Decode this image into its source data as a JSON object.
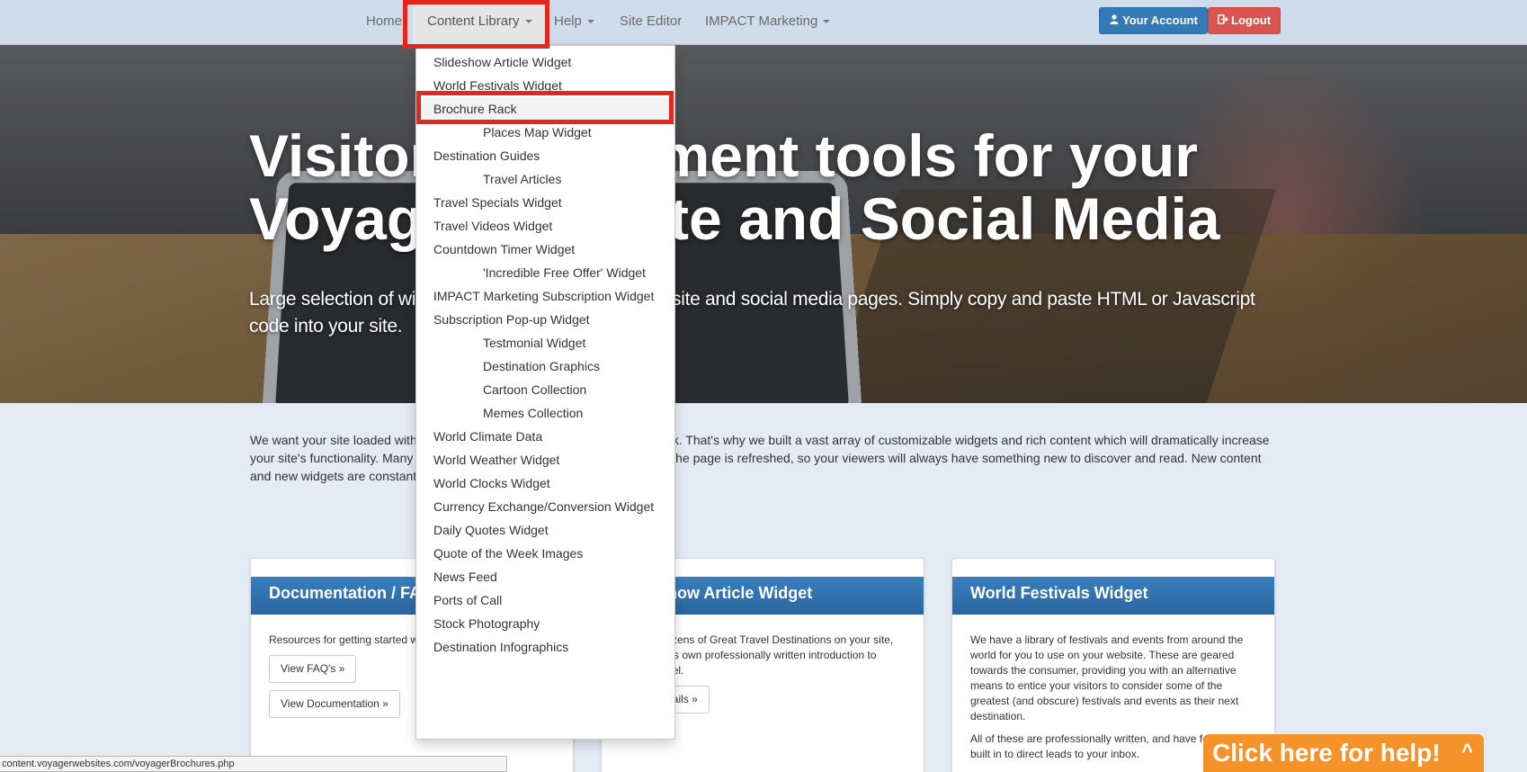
{
  "nav": {
    "home": "Home",
    "content_library": "Content Library",
    "help": "Help",
    "site_editor": "Site Editor",
    "impact_marketing": "IMPACT Marketing",
    "your_account": "Your Account",
    "logout": "Logout"
  },
  "hero": {
    "title_line1": "Visitor engagement tools for your",
    "title_line2": "Voyager Website and Social Media",
    "subtitle": "Large selection of widgets and content for your web site and social media pages. Simply copy and paste HTML or Javascript code into your site."
  },
  "intro": "We want your site loaded with rich content that will keep visitors coming back. That's why we built a vast array of customizable widgets and rich content which will dramatically increase your site's functionality. Many of our widgets deliver new content every time the page is refreshed, so your viewers will always have something new to discover and read. New content and new widgets are constantly added.",
  "dropdown": {
    "items": [
      {
        "label": "Slideshow Article Widget"
      },
      {
        "label": "World Festivals Widget"
      },
      {
        "label": "Brochure Rack"
      },
      {
        "label": "Places Map Widget"
      },
      {
        "label": "Destination Guides"
      },
      {
        "label": "Travel Articles"
      },
      {
        "label": "Travel Specials Widget"
      },
      {
        "label": "Travel Videos Widget"
      },
      {
        "label": "Countdown Timer Widget"
      },
      {
        "label": "'Incredible Free Offer' Widget"
      },
      {
        "label": "IMPACT Marketing Subscription Widget"
      },
      {
        "label": "Subscription Pop-up Widget"
      },
      {
        "label": "Testmonial Widget"
      },
      {
        "label": "Destination Graphics"
      },
      {
        "label": "Cartoon Collection"
      },
      {
        "label": "Memes Collection"
      },
      {
        "label": "World Climate Data"
      },
      {
        "label": "World Weather Widget"
      },
      {
        "label": "World Clocks Widget"
      },
      {
        "label": "Currency Exchange/Conversion Widget"
      },
      {
        "label": "Daily Quotes Widget"
      },
      {
        "label": "Quote of the Week Images"
      },
      {
        "label": "News Feed"
      },
      {
        "label": "Ports of Call"
      },
      {
        "label": "Stock Photography"
      },
      {
        "label": "Destination Infographics"
      }
    ]
  },
  "panels": {
    "docs": {
      "title": "Documentation / FAQ's & Videos",
      "body": "Resources for getting started with Voyager Websites.",
      "btn_faq": "View FAQ's »",
      "btn_docs": "View Documentation »"
    },
    "slideshow": {
      "title": "Slideshow Article Widget",
      "body": "Feature dozens of Great Travel Destinations on your site, each with its own professionally written introduction to inspire travel.",
      "btn_details": "View details »"
    },
    "festivals": {
      "title": "World Festivals Widget",
      "body1": "We have a library of festivals and events from around the world for you to use on your website. These are geared towards the consumer, providing you with an alternative means to entice your visitors to consider some of the greatest (and obscure) festivals and events as their next destination.",
      "body2": "All of these are professionally written, and have features built in to direct leads to your inbox."
    }
  },
  "status_url": "content.voyagerwebsites.com/voyagerBrochures.php",
  "help_tab": {
    "label": "Click here for help!",
    "chevron": "^"
  }
}
